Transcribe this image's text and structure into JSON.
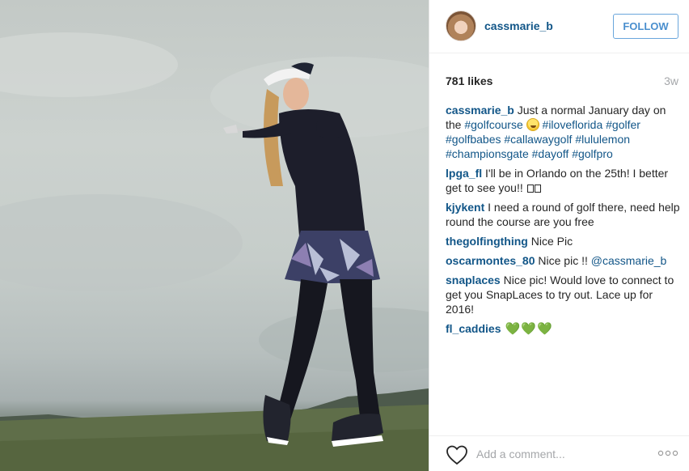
{
  "post": {
    "username": "cassmarie_b",
    "follow_label": "FOLLOW",
    "likes": "781 likes",
    "age": "3w"
  },
  "comments": [
    {
      "user": "cassmarie_b",
      "text_before": " Just a normal January day on the ",
      "tag1": "#golfcourse",
      "emoji": "smiley-emoji",
      "tags": " #iloveflorida #golfer #golfbabes #callawaygolf #lululemon #championsgate #dayoff #golfpro"
    },
    {
      "user": "lpga_fl",
      "text": " I'll be in Orlando on the 25th! I better get to see you!! "
    },
    {
      "user": "kjykent",
      "text": " I need a round of golf there, need help round the course are you free"
    },
    {
      "user": "thegolfingthing",
      "text": " Nice Pic"
    },
    {
      "user": "oscarmontes_80",
      "text": " Nice pic !! ",
      "mention": "@cassmarie_b"
    },
    {
      "user": "snaplaces",
      "text": " Nice pic! Would love to connect to get you SnapLaces to try out. Lace up for 2016!"
    },
    {
      "user": "fl_caddies",
      "text": " 💚💚💚"
    }
  ],
  "footer": {
    "comment_placeholder": "Add a comment...",
    "like_icon": "heart-outline-icon",
    "more_icon": "ellipsis-icon"
  },
  "colors": {
    "link": "#125688",
    "follow": "#3897f0",
    "muted": "#a5a7aa"
  }
}
